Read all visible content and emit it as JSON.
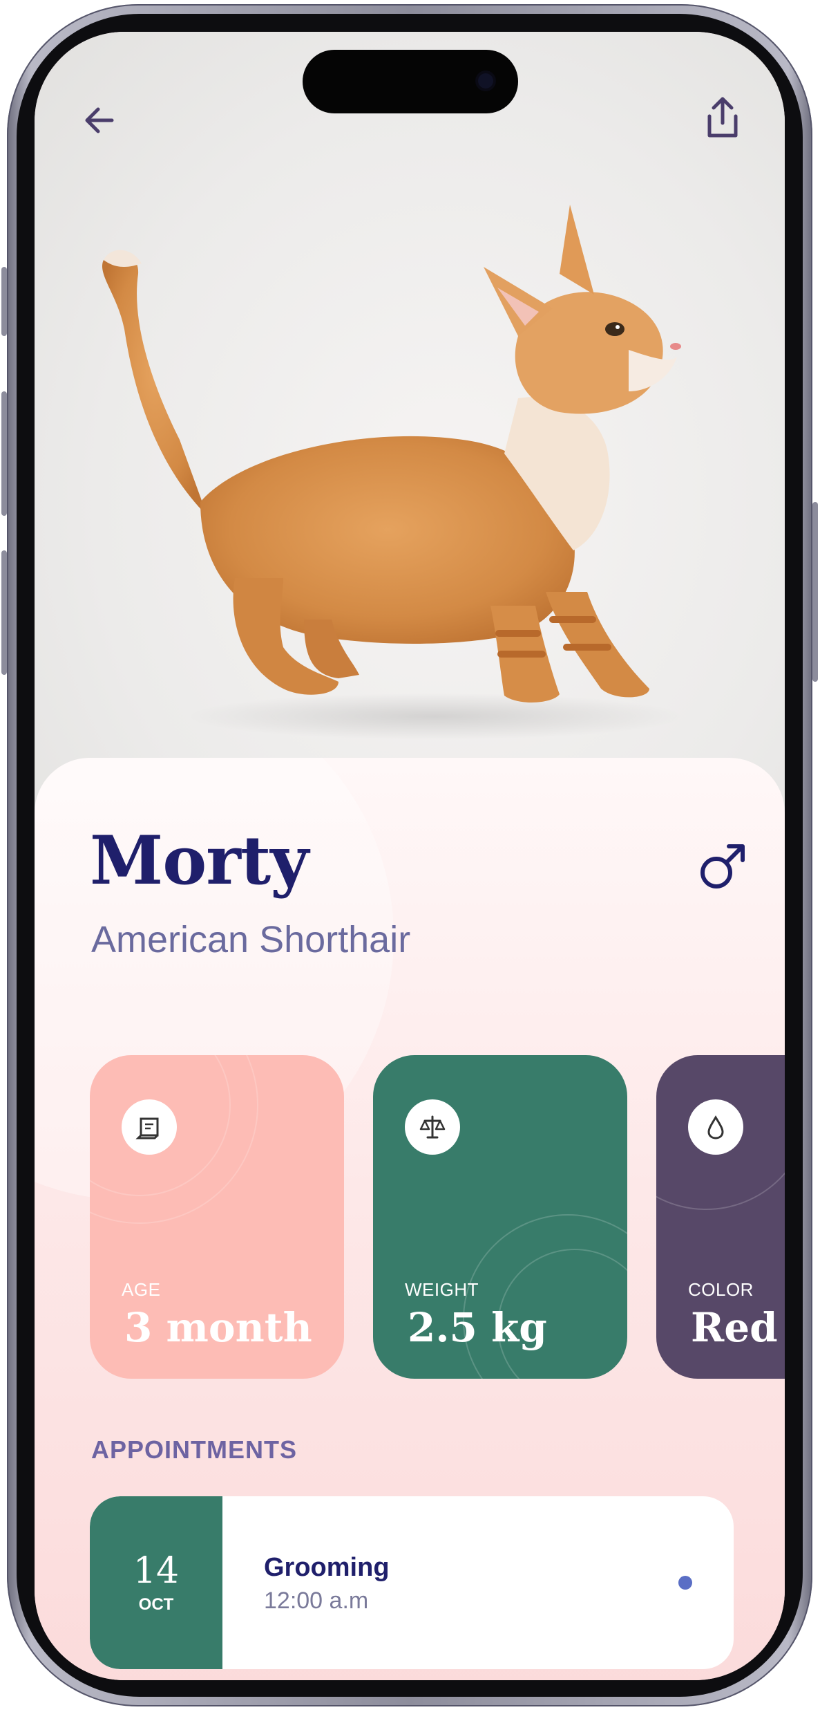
{
  "header": {
    "back_icon": "arrow-left-icon",
    "share_icon": "share-icon"
  },
  "pet": {
    "name": "Morty",
    "breed": "American Shorthair",
    "gender_icon": "male-icon"
  },
  "stats": [
    {
      "label": "AGE",
      "value": "3 month",
      "icon": "calendar-icon",
      "color": "#fdbcb5"
    },
    {
      "label": "WEIGHT",
      "value": "2.5 kg",
      "icon": "scale-icon",
      "color": "#387c6a"
    },
    {
      "label": "COLOR",
      "value": "Red",
      "icon": "drop-icon",
      "color": "#574868"
    }
  ],
  "appointments": {
    "title": "APPOINTMENTS",
    "items": [
      {
        "day": "14",
        "month": "OCT",
        "title": "Grooming",
        "time": "12:00 a.m",
        "status_color": "#5a6ec5"
      }
    ]
  },
  "colors": {
    "primary_text": "#1f1f6b",
    "secondary_text": "#6a6a9e",
    "accent_green": "#387c6a",
    "accent_pink": "#fdbcb5",
    "accent_purple": "#574868"
  }
}
